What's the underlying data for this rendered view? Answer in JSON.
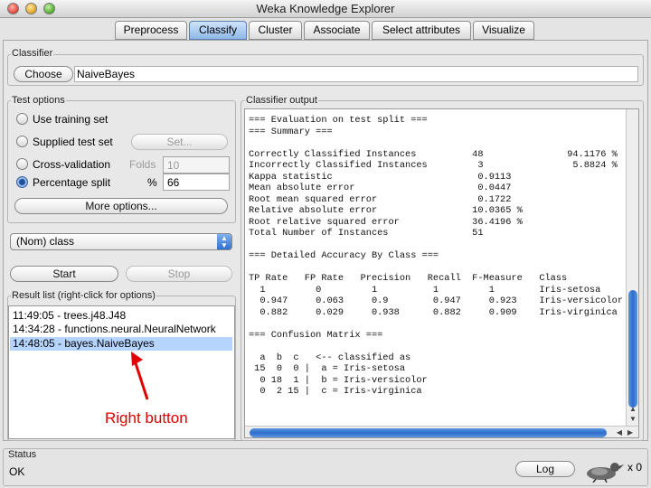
{
  "window": {
    "title": "Weka Knowledge Explorer"
  },
  "tabs": [
    {
      "label": "Preprocess"
    },
    {
      "label": "Classify"
    },
    {
      "label": "Cluster"
    },
    {
      "label": "Associate"
    },
    {
      "label": "Select attributes"
    },
    {
      "label": "Visualize"
    }
  ],
  "active_tab": "Classify",
  "classifier": {
    "group_label": "Classifier",
    "choose_label": "Choose",
    "value": "NaiveBayes"
  },
  "test_options": {
    "group_label": "Test options",
    "options": [
      {
        "label": "Use training set"
      },
      {
        "label": "Supplied test set"
      },
      {
        "label": "Cross-validation"
      },
      {
        "label": "Percentage split"
      }
    ],
    "selected": "Percentage split",
    "set_label": "Set...",
    "folds_label": "Folds",
    "folds_value": "10",
    "percent_label": "%",
    "percent_value": "66",
    "more_options_label": "More options..."
  },
  "class_select": {
    "value": "(Nom) class"
  },
  "start_label": "Start",
  "stop_label": "Stop",
  "result_list": {
    "group_label": "Result list (right-click for options)",
    "items": [
      {
        "label": "11:49:05 - trees.j48.J48"
      },
      {
        "label": "14:34:28 - functions.neural.NeuralNetwork"
      },
      {
        "label": "14:48:05 - bayes.NaiveBayes"
      }
    ],
    "selected_index": 2
  },
  "annotation": {
    "text": "Right button",
    "color": "#e00000"
  },
  "output": {
    "group_label": "Classifier output",
    "lines": [
      "=== Evaluation on test split ===",
      "=== Summary ===",
      "",
      "Correctly Classified Instances          48               94.1176 %",
      "Incorrectly Classified Instances         3                5.8824 %",
      "Kappa statistic                          0.9113",
      "Mean absolute error                      0.0447",
      "Root mean squared error                  0.1722",
      "Relative absolute error                 10.0365 %",
      "Root relative squared error             36.4196 %",
      "Total Number of Instances               51",
      "",
      "=== Detailed Accuracy By Class ===",
      "",
      "TP Rate   FP Rate   Precision   Recall  F-Measure   Class",
      "  1         0         1          1         1        Iris-setosa",
      "  0.947     0.063     0.9        0.947     0.923    Iris-versicolor",
      "  0.882     0.029     0.938      0.882     0.909    Iris-virginica",
      "",
      "=== Confusion Matrix ===",
      "",
      "  a  b  c   <-- classified as",
      " 15  0  0 |  a = Iris-setosa",
      "  0 18  1 |  b = Iris-versicolor",
      "  0  2 15 |  c = Iris-virginica"
    ]
  },
  "status": {
    "group_label": "Status",
    "text": "OK",
    "log_label": "Log",
    "count": "x 0"
  },
  "colors": {
    "active_tab": "#8fb8e8",
    "selection": "#b5d5ff",
    "scroll_thumb": "#2e6dcc",
    "annotation": "#e00000"
  },
  "icons": [
    "weka-bird-icon",
    "select-arrows-icon",
    "red-arrow"
  ]
}
